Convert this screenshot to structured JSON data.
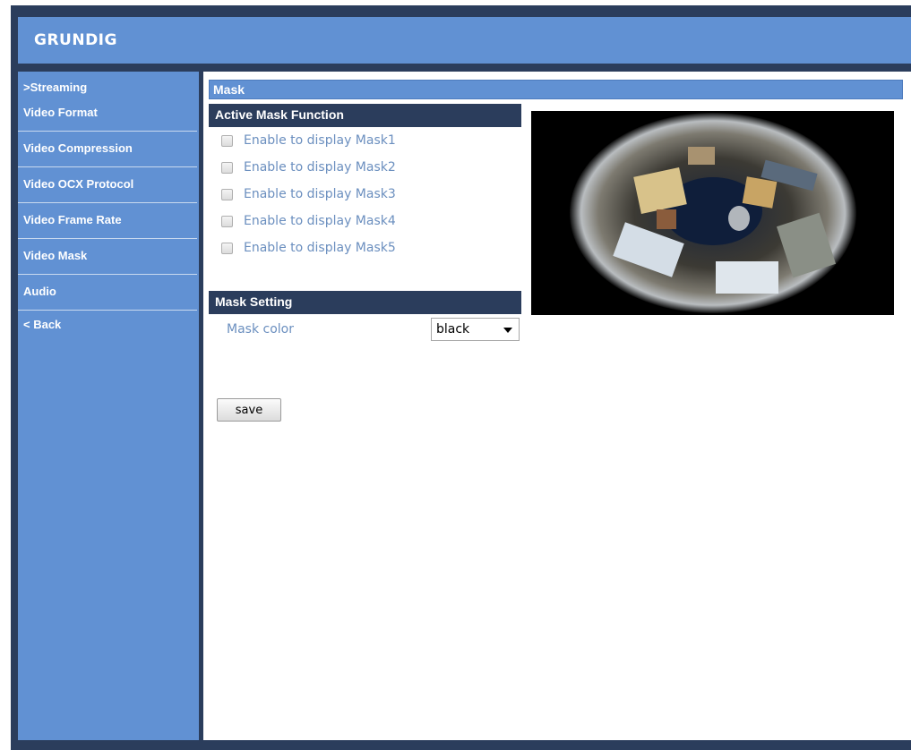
{
  "brand": {
    "logo_text": "GRUNDIG"
  },
  "sidebar": {
    "items": [
      {
        "label": ">Streaming"
      },
      {
        "label": "Video Format"
      },
      {
        "label": "Video Compression"
      },
      {
        "label": "Video OCX Protocol"
      },
      {
        "label": "Video Frame Rate"
      },
      {
        "label": "Video Mask"
      },
      {
        "label": "Audio"
      },
      {
        "label": "< Back"
      }
    ]
  },
  "main": {
    "title": "Mask",
    "active_mask": {
      "heading": "Active Mask Function",
      "options": [
        {
          "label": "Enable to display Mask1",
          "checked": false
        },
        {
          "label": "Enable to display Mask2",
          "checked": false
        },
        {
          "label": "Enable to display Mask3",
          "checked": false
        },
        {
          "label": "Enable to display Mask4",
          "checked": false
        },
        {
          "label": "Enable to display Mask5",
          "checked": false
        }
      ]
    },
    "mask_setting": {
      "heading": "Mask Setting",
      "color_label": "Mask color",
      "color_value": "black"
    },
    "save_label": "save"
  },
  "colors": {
    "nav_blue": "#6191d3",
    "dark_navy": "#2b3d5c",
    "label_blue": "#6b8fbf"
  },
  "icons": {
    "dropdown": "chevron-down-icon",
    "checkbox": "checkbox-icon"
  }
}
